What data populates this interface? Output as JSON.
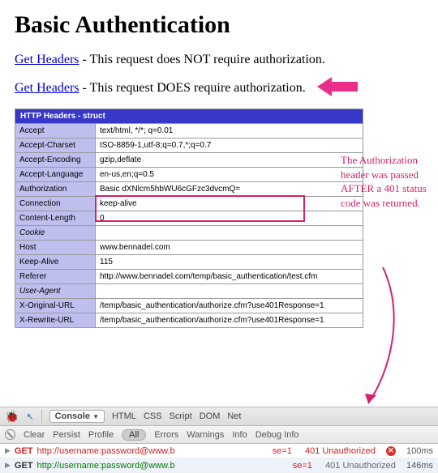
{
  "page": {
    "title": "Basic Authentication",
    "link1_text": "Get Headers",
    "link1_desc": " - This request does NOT require authorization.",
    "link2_text": "Get Headers",
    "link2_desc": " - This request DOES require authorization."
  },
  "table": {
    "title": "HTTP Headers - struct",
    "rows": [
      {
        "k": "Accept",
        "v": "text/html, */*; q=0.01",
        "ital": false
      },
      {
        "k": "Accept-Charset",
        "v": "ISO-8859-1,utf-8;q=0.7,*;q=0.7",
        "ital": false
      },
      {
        "k": "Accept-Encoding",
        "v": "gzip,deflate",
        "ital": false
      },
      {
        "k": "Accept-Language",
        "v": "en-us,en;q=0.5",
        "ital": false
      },
      {
        "k": "Authorization",
        "v": "Basic dXNlcm5hbWU6cGFzc3dvcmQ=",
        "ital": false
      },
      {
        "k": "Connection",
        "v": "keep-alive",
        "ital": false
      },
      {
        "k": "Content-Length",
        "v": "0",
        "ital": false
      },
      {
        "k": "Cookie",
        "v": "",
        "ital": true
      },
      {
        "k": "Host",
        "v": "www.bennadel.com",
        "ital": false
      },
      {
        "k": "Keep-Alive",
        "v": "115",
        "ital": false
      },
      {
        "k": "Referer",
        "v": "http://www.bennadel.com/temp/basic_authentication/test.cfm",
        "ital": false
      },
      {
        "k": "User-Agent",
        "v": "",
        "ital": true
      },
      {
        "k": "X-Original-URL",
        "v": "/temp/basic_authentication/authorize.cfm?use401Response=1",
        "ital": false
      },
      {
        "k": "X-Rewrite-URL",
        "v": "/temp/basic_authentication/authorize.cfm?use401Response=1",
        "ital": false
      }
    ]
  },
  "annotation": {
    "text": "The Authorization header was passed AFTER a 401 status code was returned."
  },
  "devtools": {
    "tabs": [
      "Console",
      "HTML",
      "CSS",
      "Script",
      "DOM",
      "Net"
    ],
    "subbar": {
      "clear": "Clear",
      "persist": "Persist",
      "profile": "Profile",
      "all": "All",
      "errors": "Errors",
      "warnings": "Warnings",
      "info": "Info",
      "debug": "Debug Info"
    },
    "rows": [
      {
        "method": "GET",
        "method_red": true,
        "url": "http://username:password@www.b",
        "se": "se=1",
        "status": "401 Unauthorized",
        "err": true,
        "time": "100ms",
        "status_gray": false
      },
      {
        "method": "GET",
        "method_red": false,
        "url": "http://username:password@www.b",
        "se": "se=1",
        "status": "401 Unauthorized",
        "err": false,
        "time": "146ms",
        "status_gray": true
      }
    ]
  }
}
